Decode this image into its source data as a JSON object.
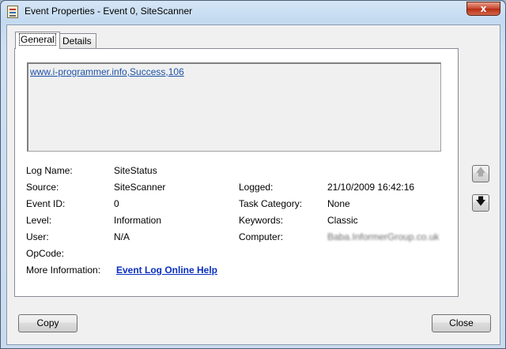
{
  "window": {
    "title": "Event Properties - Event 0, SiteScanner",
    "close_label": "x"
  },
  "tabs": [
    {
      "label": "General",
      "active": true
    },
    {
      "label": "Details",
      "active": false
    }
  ],
  "message": "www.i-programmer.info,Success,106",
  "fields": {
    "log_name": {
      "label": "Log Name:",
      "value": "SiteStatus"
    },
    "source": {
      "label": "Source:",
      "value": "SiteScanner"
    },
    "event_id": {
      "label": "Event ID:",
      "value": "0"
    },
    "level": {
      "label": "Level:",
      "value": "Information"
    },
    "user": {
      "label": "User:",
      "value": "N/A"
    },
    "opcode": {
      "label": "OpCode:",
      "value": ""
    },
    "more_info": {
      "label": "More Information:",
      "link": "Event Log Online Help"
    },
    "logged": {
      "label": "Logged:",
      "value": "21/10/2009 16:42:16"
    },
    "task_category": {
      "label": "Task Category:",
      "value": "None"
    },
    "keywords": {
      "label": "Keywords:",
      "value": "Classic"
    },
    "computer": {
      "label": "Computer:",
      "value": "Baba.InformerGroup.co.uk"
    }
  },
  "nav": {
    "up_icon": "arrow-up-icon",
    "down_icon": "arrow-down-icon",
    "up_glyph": "🡅",
    "down_glyph": "🡇"
  },
  "buttons": {
    "copy": "Copy",
    "close": "Close"
  }
}
